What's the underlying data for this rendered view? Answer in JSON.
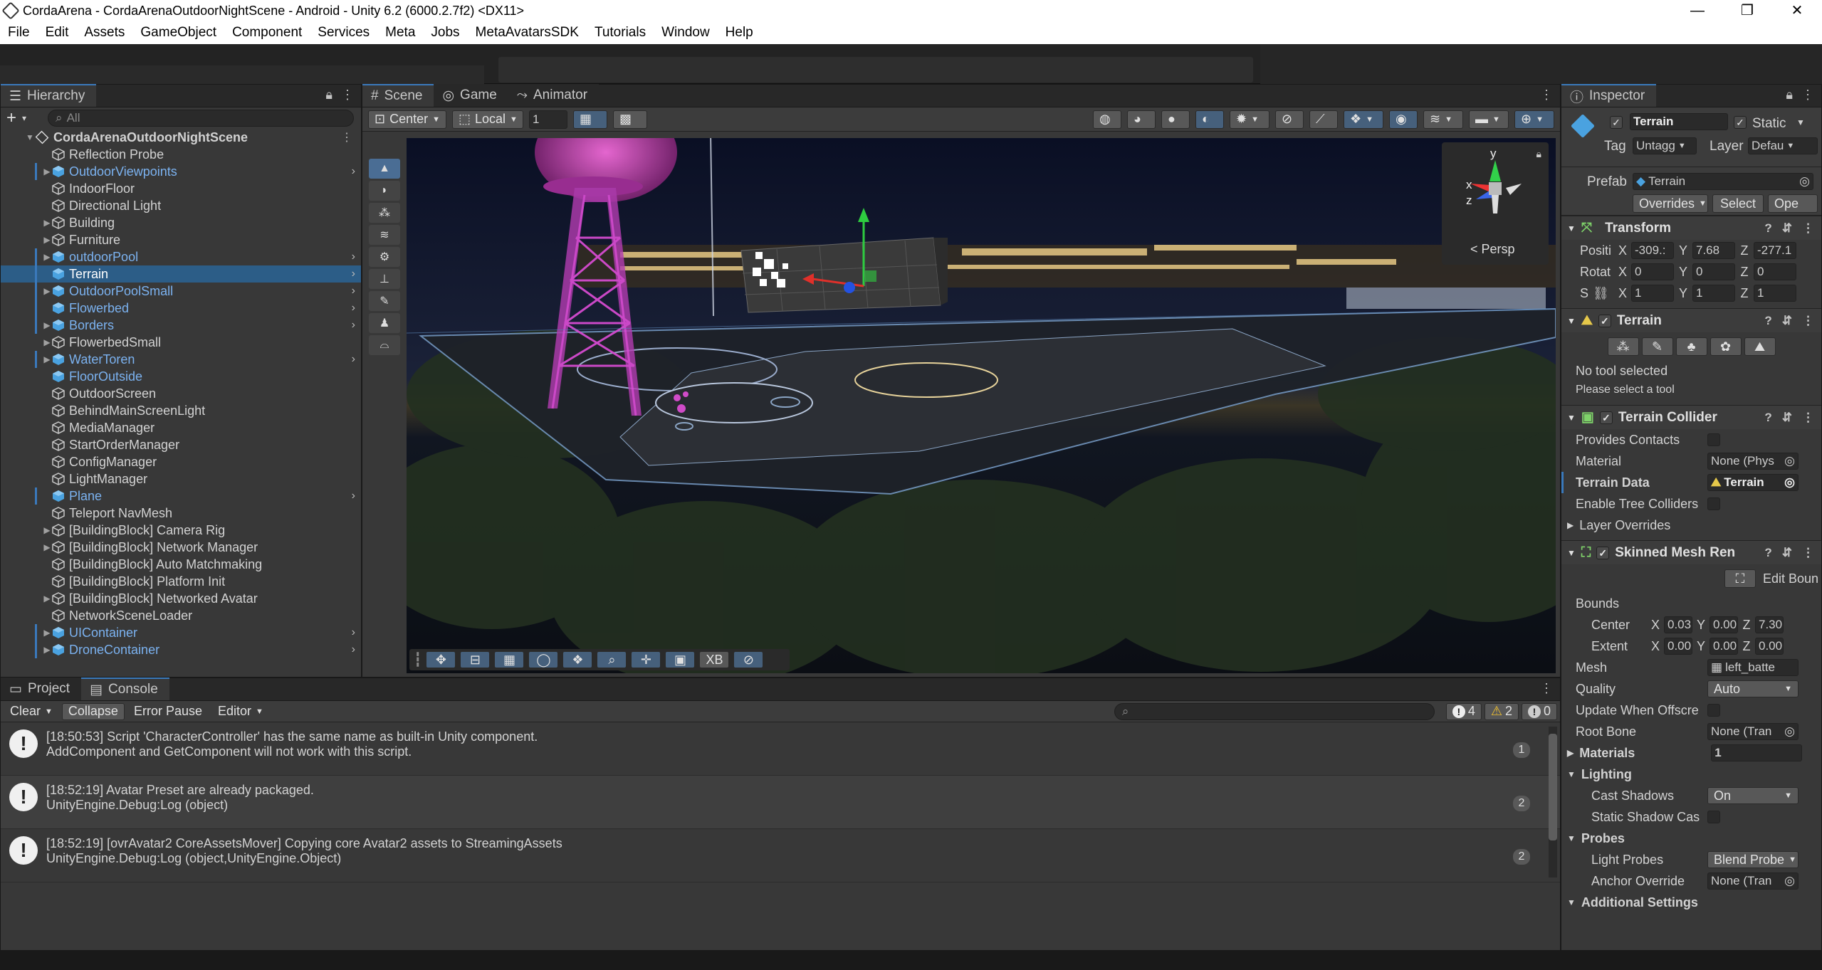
{
  "window": {
    "title": "CordaArena - CordaArenaOutdoorNightScene - Android - Unity 6.2 (6000.2.7f2) <DX11>",
    "controls": [
      "—",
      "❐",
      "✕"
    ]
  },
  "menu": [
    "File",
    "Edit",
    "Assets",
    "GameObject",
    "Component",
    "Services",
    "Meta",
    "Jobs",
    "MetaAvatarsSDK",
    "Tutorials",
    "Window",
    "Help"
  ],
  "hierarchy": {
    "tab": "Hierarchy",
    "add_label": "+",
    "search_placeholder": "All",
    "scene_name": "CordaArenaOutdoorNightScene",
    "items": [
      {
        "label": "Reflection Probe",
        "prefab": false,
        "expand": false,
        "chevron": false
      },
      {
        "label": "OutdoorViewpoints",
        "prefab": true,
        "expand": true,
        "chevron": true
      },
      {
        "label": "IndoorFloor",
        "prefab": false,
        "expand": false,
        "chevron": false
      },
      {
        "label": "Directional Light",
        "prefab": false,
        "expand": false,
        "chevron": false
      },
      {
        "label": "Building",
        "prefab": false,
        "expand": true,
        "chevron": false
      },
      {
        "label": "Furniture",
        "prefab": false,
        "expand": true,
        "chevron": false
      },
      {
        "label": "outdoorPool",
        "prefab": true,
        "expand": true,
        "chevron": true
      },
      {
        "label": "Terrain",
        "prefab": true,
        "expand": false,
        "chevron": true,
        "selected": true
      },
      {
        "label": "OutdoorPoolSmall",
        "prefab": true,
        "expand": true,
        "chevron": true
      },
      {
        "label": "Flowerbed",
        "prefab": true,
        "expand": false,
        "chevron": true
      },
      {
        "label": "Borders",
        "prefab": true,
        "expand": true,
        "chevron": true
      },
      {
        "label": "FlowerbedSmall",
        "prefab": false,
        "expand": true,
        "chevron": false
      },
      {
        "label": "WaterToren",
        "prefab": true,
        "expand": true,
        "chevron": true
      },
      {
        "label": "FloorOutside",
        "prefab": true,
        "expand": false,
        "chevron": false
      },
      {
        "label": "OutdoorScreen",
        "prefab": false,
        "expand": false,
        "chevron": false
      },
      {
        "label": "BehindMainScreenLight",
        "prefab": false,
        "expand": false,
        "chevron": false
      },
      {
        "label": "MediaManager",
        "prefab": false,
        "expand": false,
        "chevron": false
      },
      {
        "label": "StartOrderManager",
        "prefab": false,
        "expand": false,
        "chevron": false
      },
      {
        "label": "ConfigManager",
        "prefab": false,
        "expand": false,
        "chevron": false
      },
      {
        "label": "LightManager",
        "prefab": false,
        "expand": false,
        "chevron": false
      },
      {
        "label": "Plane",
        "prefab": true,
        "expand": false,
        "chevron": true
      },
      {
        "label": "Teleport NavMesh",
        "prefab": false,
        "expand": false,
        "chevron": false
      },
      {
        "label": "[BuildingBlock] Camera Rig",
        "prefab": false,
        "expand": true,
        "chevron": false
      },
      {
        "label": "[BuildingBlock] Network Manager",
        "prefab": false,
        "expand": true,
        "chevron": false
      },
      {
        "label": "[BuildingBlock] Auto Matchmaking",
        "prefab": false,
        "expand": false,
        "chevron": false
      },
      {
        "label": "[BuildingBlock] Platform Init",
        "prefab": false,
        "expand": false,
        "chevron": false
      },
      {
        "label": "[BuildingBlock] Networked Avatar",
        "prefab": false,
        "expand": true,
        "chevron": false
      },
      {
        "label": "NetworkSceneLoader",
        "prefab": false,
        "expand": false,
        "chevron": false
      },
      {
        "label": "UIContainer",
        "prefab": true,
        "expand": true,
        "chevron": true
      },
      {
        "label": "DroneContainer",
        "prefab": true,
        "expand": true,
        "chevron": true
      }
    ]
  },
  "scene": {
    "tabs": [
      "Scene",
      "Game",
      "Animator"
    ],
    "pivot": "Center",
    "space": "Local",
    "snap_value": "1",
    "persp_label": "Persp",
    "gizmo_axes": {
      "y": "y",
      "x": "x",
      "z": "z"
    },
    "overlay_labels": {
      "xb": "XB"
    }
  },
  "inspector": {
    "tab": "Inspector",
    "object_name": "Terrain",
    "static_label": "Static",
    "tag_label": "Tag",
    "tag_value": "Untagg",
    "layer_label": "Layer",
    "layer_value": "Defau",
    "prefab_label": "Prefab",
    "prefab_value": "Terrain",
    "overrides": "Overrides",
    "select": "Select",
    "open": "Ope",
    "transform": {
      "title": "Transform",
      "position_label": "Positi",
      "rotation_label": "Rotat",
      "scale_label": "S",
      "position": {
        "x": "-309.:",
        "y": "7.68",
        "z": "-277.1"
      },
      "rotation": {
        "x": "0",
        "y": "0",
        "z": "0"
      },
      "scale": {
        "x": "1",
        "y": "1",
        "z": "1"
      }
    },
    "terrain": {
      "title": "Terrain",
      "no_tool": "No tool selected",
      "hint": "Please select a tool"
    },
    "terrain_collider": {
      "title": "Terrain Collider",
      "provides_contacts": "Provides Contacts",
      "material": "Material",
      "material_value": "None (Phys",
      "terrain_data": "Terrain Data",
      "terrain_data_value": "Terrain",
      "enable_tree": "Enable Tree Colliders",
      "layer_overrides": "Layer Overrides"
    },
    "skinned": {
      "title": "Skinned Mesh Ren",
      "edit_bounds": "Edit Boun",
      "bounds": "Bounds",
      "center": "Center",
      "extent": "Extent",
      "center_vals": {
        "x": "0.03",
        "y": "0.00",
        "z": "7.30"
      },
      "extent_vals": {
        "x": "0.00",
        "y": "0.00",
        "z": "0.00"
      },
      "mesh": "Mesh",
      "mesh_value": "left_batte",
      "quality": "Quality",
      "quality_value": "Auto",
      "update_offscreen": "Update When Offscre",
      "root_bone": "Root Bone",
      "root_bone_value": "None (Tran",
      "materials": "Materials",
      "materials_count": "1",
      "lighting": "Lighting",
      "cast_shadows": "Cast Shadows",
      "cast_shadows_value": "On",
      "static_shadow": "Static Shadow Cas",
      "probes": "Probes",
      "light_probes": "Light Probes",
      "light_probes_value": "Blend Probe",
      "anchor_override": "Anchor Override",
      "anchor_value": "None (Tran",
      "additional": "Additional Settings"
    }
  },
  "console": {
    "tabs": [
      "Project",
      "Console"
    ],
    "buttons": {
      "clear": "Clear",
      "collapse": "Collapse",
      "error_pause": "Error Pause",
      "editor": "Editor"
    },
    "counts": {
      "info": "4",
      "warn": "2",
      "error": "0"
    },
    "entries": [
      {
        "line1": "[18:50:53] Script 'CharacterController' has the same name as built-in Unity component.",
        "line2": "AddComponent and GetComponent will not work with this script.",
        "count": "1"
      },
      {
        "line1": "[18:52:19] Avatar Preset are already packaged.",
        "line2": "UnityEngine.Debug:Log (object)",
        "count": "2"
      },
      {
        "line1": "[18:52:19] [ovrAvatar2 CoreAssetsMover] Copying core Avatar2 assets to StreamingAssets",
        "line2": "UnityEngine.Debug:Log (object,UnityEngine.Object)",
        "count": "2"
      }
    ]
  },
  "colors": {
    "accent": "#3a79bb",
    "prefab": "#7bb2f0",
    "selection": "#2c5d87",
    "panel": "#383838"
  }
}
